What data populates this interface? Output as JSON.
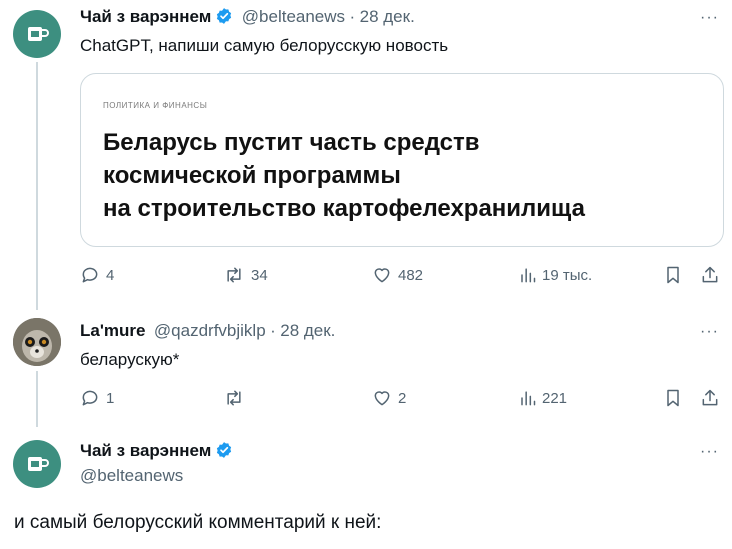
{
  "tweet1": {
    "author_name": "Чай з варэннем",
    "handle": "@belteanews",
    "separator": "·",
    "date": "28 дек.",
    "text": "ChatGPT, напиши самую белорусскую новость",
    "more": "···",
    "card": {
      "kicker": "ПОЛИТИКА И ФИНАНСЫ",
      "headline_lines": [
        "Беларусь пустит часть средств",
        "космической программы",
        "на строительство картофелехранилища"
      ]
    },
    "actions": {
      "replies": "4",
      "retweets": "34",
      "likes": "482",
      "views": "19 тыс."
    }
  },
  "tweet2": {
    "author_name": "La'mure",
    "handle": "@qazdrfvbjiklp",
    "separator": "·",
    "date": "28 дек.",
    "text": "беларускую*",
    "more": "···",
    "actions": {
      "replies": "1",
      "retweets": "",
      "likes": "2",
      "views": "221"
    }
  },
  "tweet3": {
    "author_name": "Чай з варэннем",
    "handle": "@belteanews",
    "more": "···",
    "text": "и самый белорусский комментарий к ней:"
  },
  "colors": {
    "verified_badge": "#1d9bf0",
    "secondary_text": "#536471",
    "avatar_bg": "#3d8f80"
  }
}
